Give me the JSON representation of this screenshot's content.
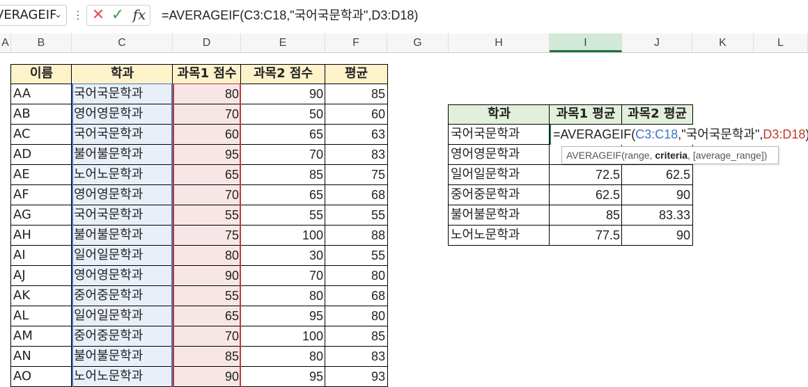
{
  "formula_bar": {
    "name_box": "VERAGEIF",
    "cancel_icon": "✕",
    "enter_icon": "✓",
    "fx_label": "fx",
    "formula": "=AVERAGEIF(C3:C18,\"국어국문학과\",D3:D18)"
  },
  "columns": [
    "A",
    "B",
    "C",
    "D",
    "E",
    "F",
    "G",
    "H",
    "I",
    "J",
    "K",
    "L"
  ],
  "selected_column": "I",
  "main_table": {
    "headers": [
      "이름",
      "학과",
      "과목1 점수",
      "과목2 점수",
      "평균"
    ],
    "rows": [
      [
        "AA",
        "국어국문학과",
        "80",
        "90",
        "85"
      ],
      [
        "AB",
        "영어영문학과",
        "70",
        "50",
        "60"
      ],
      [
        "AC",
        "국어국문학과",
        "60",
        "65",
        "63"
      ],
      [
        "AD",
        "불어불문학과",
        "95",
        "70",
        "83"
      ],
      [
        "AE",
        "노어노문학과",
        "65",
        "85",
        "75"
      ],
      [
        "AF",
        "영어영문학과",
        "70",
        "65",
        "68"
      ],
      [
        "AG",
        "국어국문학과",
        "55",
        "55",
        "55"
      ],
      [
        "AH",
        "불어불문학과",
        "75",
        "100",
        "88"
      ],
      [
        "AI",
        "일어일문학과",
        "80",
        "30",
        "55"
      ],
      [
        "AJ",
        "영어영문학과",
        "90",
        "70",
        "80"
      ],
      [
        "AK",
        "중어중문학과",
        "55",
        "80",
        "68"
      ],
      [
        "AL",
        "일어일문학과",
        "65",
        "95",
        "80"
      ],
      [
        "AM",
        "중어중문학과",
        "70",
        "100",
        "85"
      ],
      [
        "AN",
        "불어불문학과",
        "85",
        "80",
        "83"
      ],
      [
        "AO",
        "노어노문학과",
        "90",
        "95",
        "93"
      ]
    ]
  },
  "summary_table": {
    "headers": [
      "학과",
      "과목1 평균",
      "과목2 평균"
    ],
    "rows": [
      [
        "국어국문학과",
        "",
        ""
      ],
      [
        "영어영문학과",
        "",
        ""
      ],
      [
        "일어일문학과",
        "72.5",
        "62.5"
      ],
      [
        "중어중문학과",
        "62.5",
        "90"
      ],
      [
        "불어불문학과",
        "85",
        "83.33"
      ],
      [
        "노어노문학과",
        "77.5",
        "90"
      ]
    ]
  },
  "edit_cell": {
    "prefix": "=AVERAGEIF(",
    "range_ref": "C3:C18",
    "criteria": ",\"국어국문학과\",",
    "avg_ref": "D3:D18",
    "suffix": ")"
  },
  "tooltip": {
    "func": "AVERAGEIF(range, ",
    "bold_arg": "criteria",
    "rest": ", [average_range])"
  },
  "colors": {
    "header_yellow": "#fef2cb",
    "header_green": "#e2efda",
    "ref_blue": "#4472c4",
    "ref_red": "#c0392b",
    "selection_green": "#1e7145"
  }
}
